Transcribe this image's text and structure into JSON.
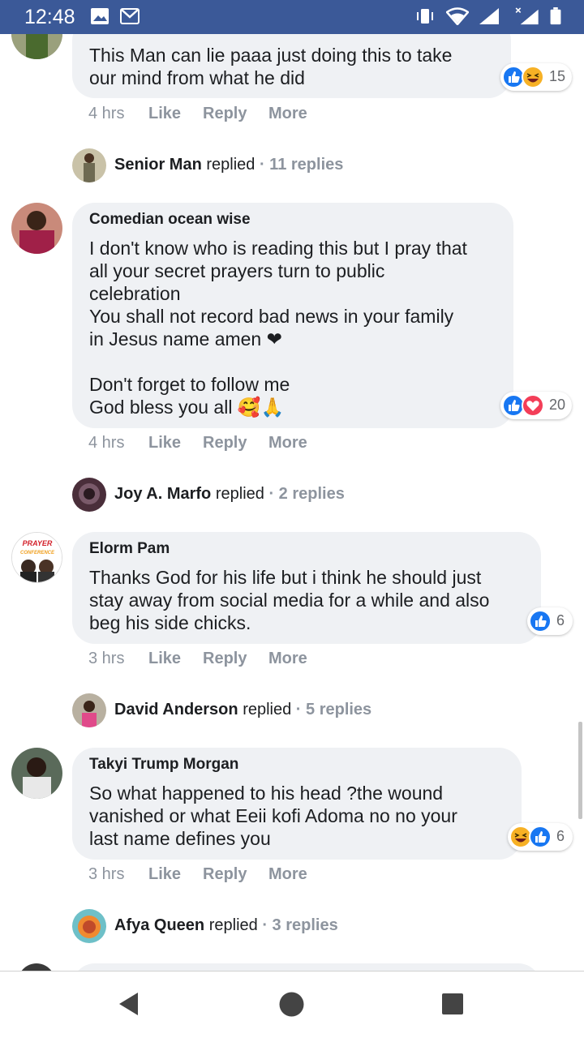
{
  "status_bar": {
    "time": "12:48"
  },
  "comments": [
    {
      "author": "",
      "text": "This Man can lie paaa just doing this to take\nour mind from what he did",
      "time": "4 hrs",
      "reaction_count": "15"
    },
    {
      "author": "Comedian ocean wise",
      "text": "I don't know who is reading this but I pray that\nall your secret prayers turn to public\ncelebration\nYou shall not record bad news in your family\nin Jesus name amen ❤\n\nDon't forget to follow me\nGod bless you all 🥰🙏",
      "time": "4 hrs",
      "reaction_count": "20"
    },
    {
      "author": "Elorm Pam",
      "text": "Thanks God for his life but i think he should just\nstay away from social media for a while and also\nbeg his side chicks.",
      "time": "3 hrs",
      "reaction_count": "6"
    },
    {
      "author": "Takyi Trump Morgan",
      "text": "So what happened to his head ?the wound\nvanished or what Eeii kofi Adoma no no your\nlast name defines you",
      "time": "3 hrs",
      "reaction_count": "6"
    }
  ],
  "actions": {
    "like": "Like",
    "reply": "Reply",
    "more": "More"
  },
  "replies": [
    {
      "name": "Senior Man",
      "verb": "replied",
      "count": "· 11 replies"
    },
    {
      "name": "Joy A. Marfo",
      "verb": "replied",
      "count": "· 2 replies"
    },
    {
      "name": "David Anderson",
      "verb": "replied",
      "count": "· 5 replies"
    },
    {
      "name": "Afya Queen",
      "verb": "replied",
      "count": "· 3 replies"
    }
  ],
  "avatar_badge_text": {
    "line1": "PRAYER",
    "line2": "CONFERENCE"
  },
  "colors": {
    "status_bar": "#3b5998",
    "bubble": "#eff1f4",
    "like_blue": "#1877f2",
    "love_red": "#f33e58",
    "haha_yellow": "#f7b125",
    "muted": "#8d949e"
  }
}
